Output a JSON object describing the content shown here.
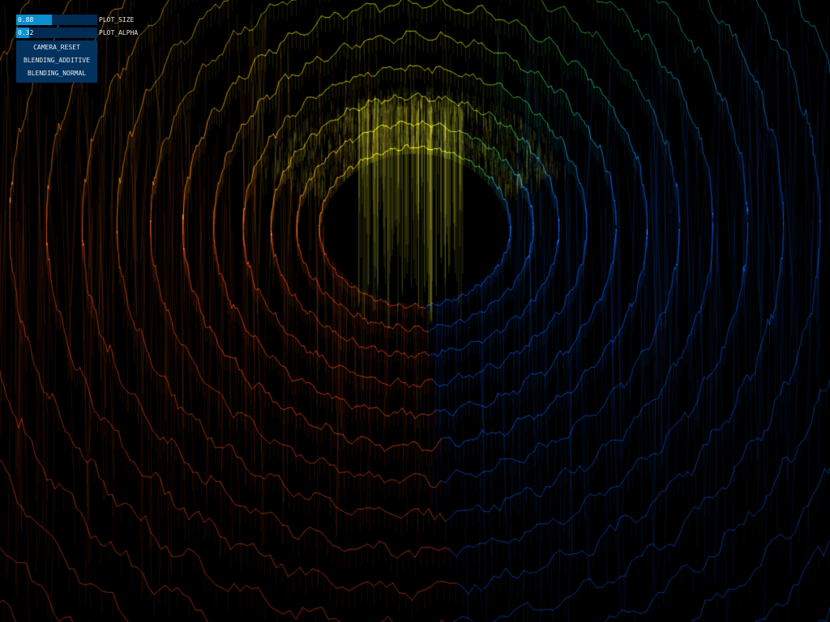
{
  "controls": {
    "sliders": [
      {
        "id": "plot_size",
        "label": "PLOT_SIZE",
        "value": "0.88",
        "level": 0.44
      },
      {
        "id": "plot_alpha",
        "label": "PLOT_ALPHA",
        "value": "0.32",
        "level": 0.16
      }
    ],
    "buttons": [
      {
        "id": "camera_reset",
        "label": "CAMERA_RESET"
      },
      {
        "id": "blending_additive",
        "label": "BLENDING_ADDITIVE"
      },
      {
        "id": "blending_normal",
        "label": "BLENDING_NORMAL"
      }
    ],
    "accent": "#0a8fd0",
    "panel_color": "#02335f"
  },
  "visualization": {
    "kind": "3d-line-plot",
    "colors": [
      "#0a4fd0",
      "#1fa0d0",
      "#1fc060",
      "#7ad020",
      "#e8e810",
      "#f0a010",
      "#d84010"
    ]
  }
}
